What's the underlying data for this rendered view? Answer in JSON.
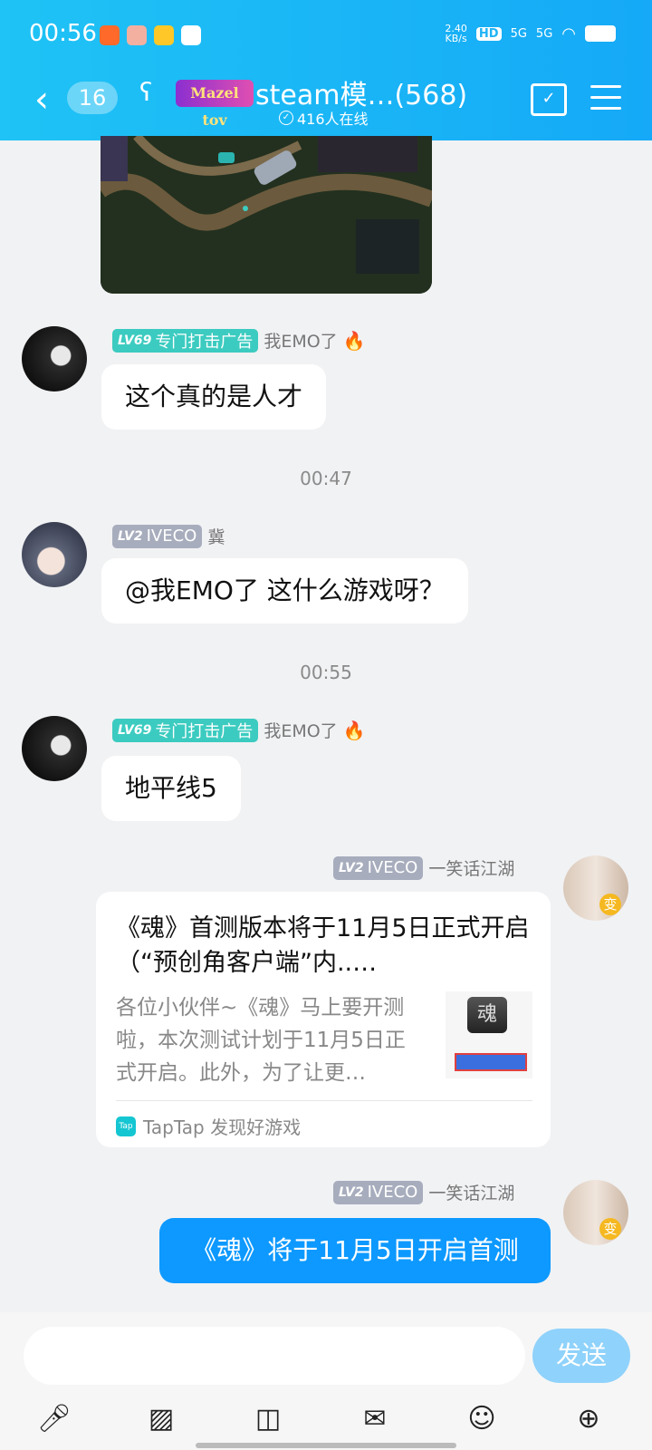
{
  "status_bar": {
    "time": "00:56",
    "net_speed_value": "2.40",
    "net_speed_unit": "KB/s",
    "hd_label": "HD",
    "signal1": "5G",
    "signal2": "5G"
  },
  "header": {
    "back_count": "16",
    "logo_text": "Mazel tov",
    "group_title": "steam模…(568)",
    "online_text": "416人在线"
  },
  "messages": [
    {
      "level": "LV69",
      "title": "专门打击广告",
      "name": "我EMO了",
      "text": "这个真的是人才"
    },
    {
      "timestamp": "00:47"
    },
    {
      "level": "LV2",
      "title": "IVECO",
      "name": "冀",
      "text": "@我EMO了 这什么游戏呀？"
    },
    {
      "timestamp": "00:55"
    },
    {
      "level": "LV69",
      "title": "专门打击广告",
      "name": "我EMO了",
      "text": "地平线5"
    },
    {
      "level": "LV2",
      "title": "IVECO",
      "name": "一笑话江湖",
      "card": {
        "title": "《魂》首测版本将于11月5日正式开启（“预创角客户端”内..…",
        "desc": "各位小伙伴~《魂》马上要开测啦，本次测试计划于11月5日正式开启。此外，为了让更…",
        "source": "TapTap 发现好游戏",
        "source_icon_text": "Tap"
      }
    },
    {
      "level": "LV2",
      "title": "IVECO",
      "name": "一笑话江湖",
      "text": "《魂》将于11月5日开启首测"
    }
  ],
  "input": {
    "placeholder": "",
    "send_label": "发送"
  },
  "toolbar": {
    "icons": [
      "mic-icon",
      "image-icon",
      "camera-icon",
      "red-packet-icon",
      "emoji-icon",
      "plus-icon"
    ]
  },
  "colors": {
    "header_start": "#1fc3f5",
    "header_end": "#15a9f7",
    "teal_level": "#3ccbc0",
    "gray_level": "#a7adbd",
    "self_bubble": "#0d99ff",
    "send_button": "#8fd2fb"
  }
}
